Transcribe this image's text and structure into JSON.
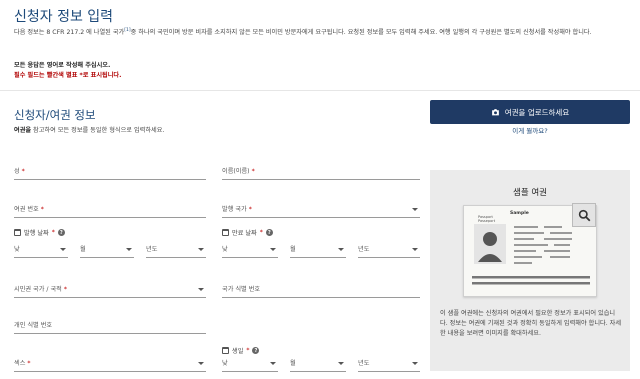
{
  "header": {
    "title": "신청자 정보 입력",
    "intro_before_sup": "다음 정보는 8 CFR 217.2 에 나열된 국가",
    "intro_sup": "[1]",
    "intro_after_sup": "중 하나의 국민이며 방문 비자를 소지하지 않은 모든 비이민 방문자에게 요구됩니다. 요청된 정보를 모두 입력해 주세요. 여행 일행의 각 구성원은 별도의 신청서를 작성해야 합니다.",
    "note_english": "모든 응답은 영어로 작성해 주십시오.",
    "note_required": "필수 필드는 빨간색 별표 *로 표시됩니다."
  },
  "section": {
    "title": "신청자/여권 정보",
    "sub_bold": "여권을",
    "sub_rest": " 참고하여 모든 정보를 동일한 형식으로 입력하세요."
  },
  "upload": {
    "button_label": "여권을 업로드하세요",
    "what_is_this": "이게 뭘까요?"
  },
  "fields": {
    "surname": "성",
    "given_name": "이름(이름)",
    "passport_number": "여권 번호",
    "issuing_country": "발행 국가",
    "issue_date": "발행 날짜",
    "expiry_date": "만료 날짜",
    "citizenship_country": "시민권 국가 / 국적",
    "national_id": "국가 식별 번호",
    "personal_id": "개인 식별 번호",
    "sex": "섹스",
    "birth_date": "생일",
    "day": "낮",
    "month": "월",
    "year": "년도",
    "required_mark": "*"
  },
  "sample_panel": {
    "title": "샘플 여권",
    "description": "이 샘플 여권에는 신청자의 여권에서 필요한 정보가 표시되어 있습니다. 정보는 여권에 기재된 것과 정확히 동일하게 입력해야 합니다. 자세한 내용을 보려면 이미지를 확대하세요.",
    "passport_heading": "Sample",
    "passport_word": "Passport",
    "passport_word_alt": "Passeport"
  },
  "colors": {
    "primary": "#1f3a64",
    "link": "#1e4a7a",
    "required": "#c00000",
    "panel_bg": "#ebebeb"
  },
  "icons": {
    "upload": "camera-icon",
    "calendar": "calendar-icon",
    "help": "help-circle-icon",
    "zoom": "magnifier-icon",
    "dropdown": "caret-down-icon"
  }
}
